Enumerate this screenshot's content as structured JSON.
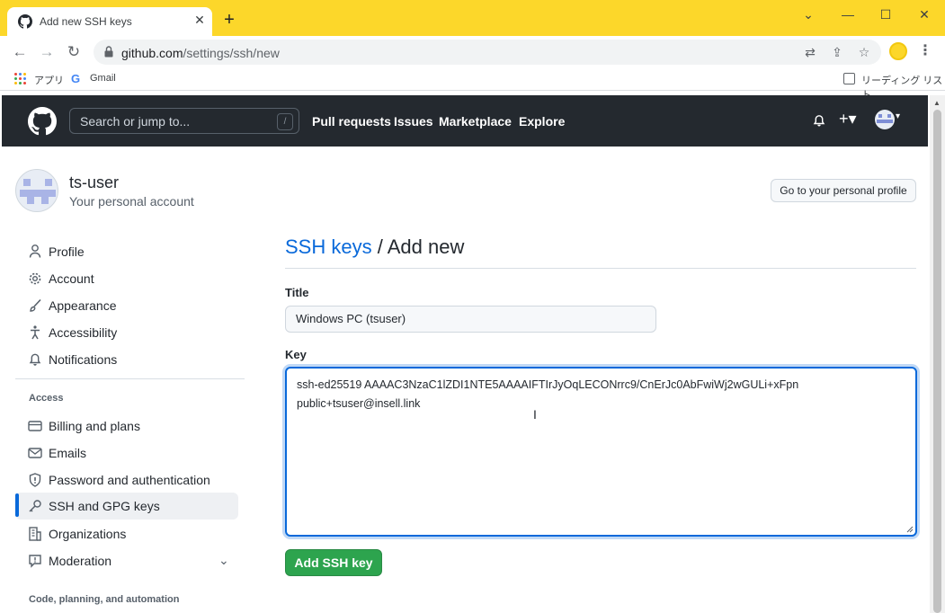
{
  "browser": {
    "tab_title": "Add new SSH keys",
    "url_host": "github.com",
    "url_path": "/settings/ssh/new",
    "bookmarks": {
      "apps": "アプリ",
      "gmail": "Gmail",
      "reading_list": "リーディング リスト"
    }
  },
  "header": {
    "search_placeholder": "Search or jump to...",
    "search_shortcut": "/",
    "nav": [
      "Pull requests",
      "Issues",
      "Marketplace",
      "Explore"
    ]
  },
  "account": {
    "username": "ts-user",
    "subtitle": "Your personal account",
    "profile_button": "Go to your personal profile"
  },
  "sidebar": {
    "items": [
      {
        "label": "Profile",
        "icon": "person-icon"
      },
      {
        "label": "Account",
        "icon": "gear-icon"
      },
      {
        "label": "Appearance",
        "icon": "paintbrush-icon"
      },
      {
        "label": "Accessibility",
        "icon": "accessibility-icon"
      },
      {
        "label": "Notifications",
        "icon": "bell-icon"
      }
    ],
    "access_heading": "Access",
    "access_items": [
      {
        "label": "Billing and plans",
        "icon": "credit-card-icon"
      },
      {
        "label": "Emails",
        "icon": "mail-icon"
      },
      {
        "label": "Password and authentication",
        "icon": "shield-icon"
      },
      {
        "label": "SSH and GPG keys",
        "icon": "key-icon",
        "active": true
      },
      {
        "label": "Organizations",
        "icon": "organization-icon"
      },
      {
        "label": "Moderation",
        "icon": "report-icon"
      }
    ],
    "code_heading": "Code, planning, and automation"
  },
  "main": {
    "breadcrumb_link": "SSH keys",
    "breadcrumb_sep": " / ",
    "breadcrumb_current": "Add new",
    "title_label": "Title",
    "title_value": "Windows PC (tsuser)",
    "key_label": "Key",
    "key_line1": "ssh-ed25519 AAAAC3NzaC1lZDI1NTE5AAAAIFTIrJyOqLECONrrc9/CnErJc0AbFwiWj2wGULi+xFpn",
    "key_line2": "public+tsuser@insell.link",
    "submit_label": "Add SSH key"
  },
  "colors": {
    "accent": "#0969da",
    "success": "#2da44e",
    "header_bg": "#24292f",
    "browser_frame": "#fcd72a"
  }
}
